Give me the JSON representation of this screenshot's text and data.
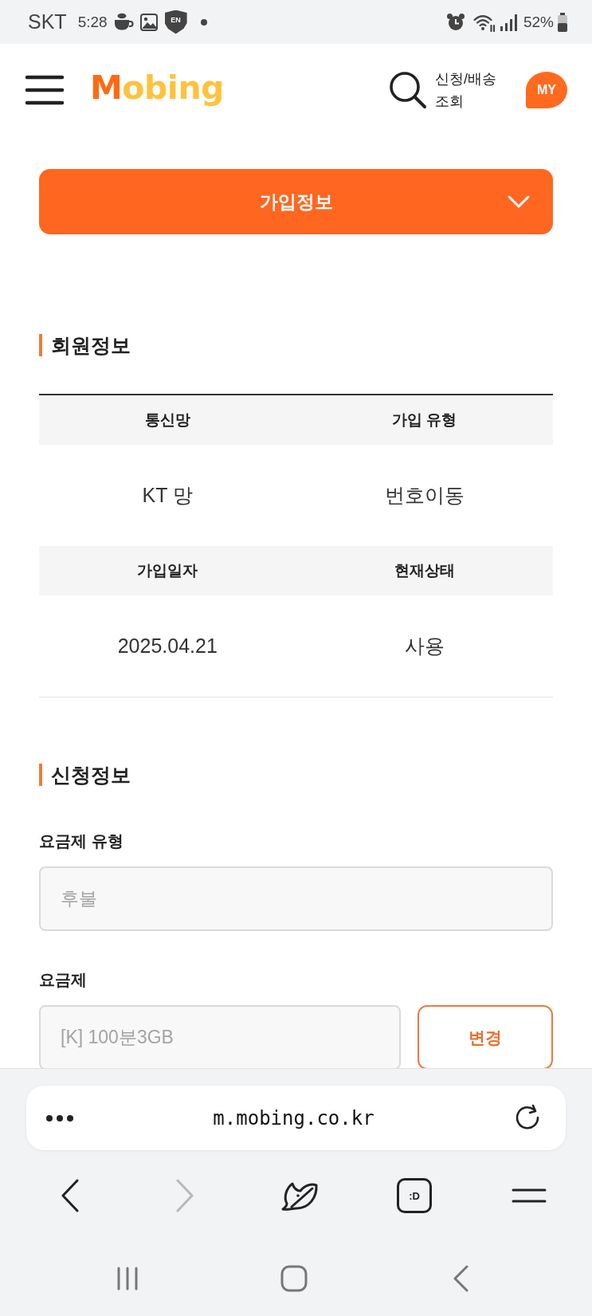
{
  "status_bar": {
    "carrier": "SKT",
    "time": "5:28",
    "vpn_badge": "EN",
    "battery": "52%"
  },
  "header": {
    "logo": "Mobing",
    "tracking_link": "신청/배송 조회",
    "my_button": "MY"
  },
  "page_menu": {
    "label": "가입정보",
    "expanded": false
  },
  "member_info": {
    "title": "회원정보",
    "rows": [
      {
        "headings": [
          "통신망",
          "가입 유형"
        ],
        "values": [
          "KT 망",
          "번호이동"
        ]
      },
      {
        "headings": [
          "가입일자",
          "현재상태"
        ],
        "values": [
          "2025.04.21",
          "사용"
        ]
      }
    ]
  },
  "application_info": {
    "title": "신청정보",
    "fields": [
      {
        "label": "요금제 유형",
        "value": "후불",
        "disabled": true
      },
      {
        "label": "요금제",
        "value": "[K] 100분3GB",
        "disabled": true,
        "button": "변경"
      }
    ]
  },
  "browser": {
    "url": "m.mobing.co.kr",
    "toolbar": [
      {
        "kind": "back",
        "disabled": false
      },
      {
        "kind": "forward",
        "disabled": true
      },
      {
        "kind": "bird",
        "disabled": false
      },
      {
        "kind": "tabs",
        "label": ":D",
        "disabled": false
      },
      {
        "kind": "menu",
        "disabled": false
      }
    ]
  }
}
